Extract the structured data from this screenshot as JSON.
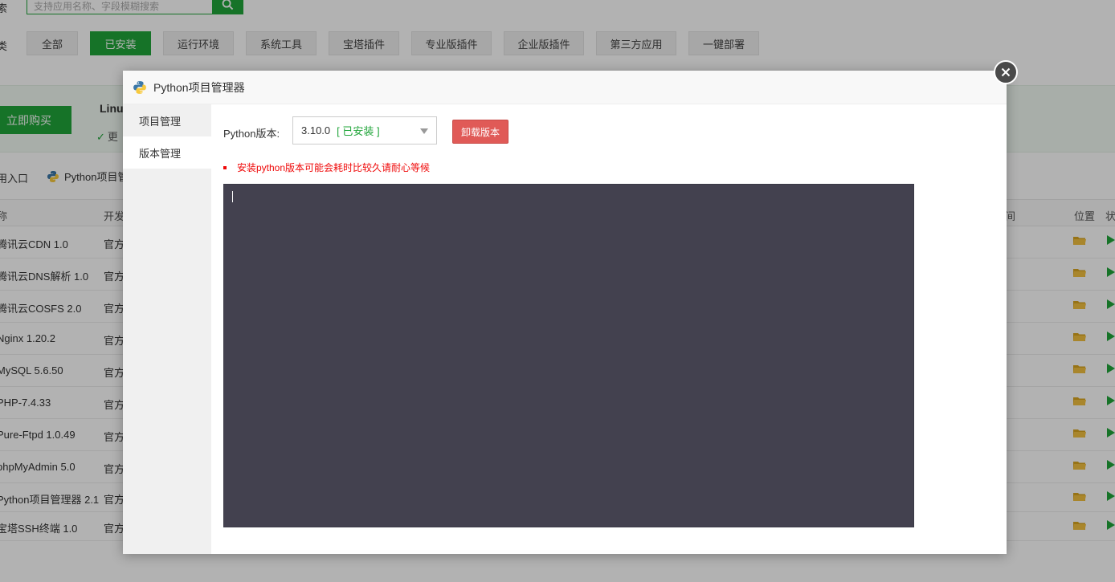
{
  "search": {
    "label": "索",
    "placeholder": "支持应用名称、字段模糊搜索"
  },
  "categories": {
    "label": "类",
    "items": [
      {
        "label": "全部",
        "active": false
      },
      {
        "label": "已安装",
        "active": true
      },
      {
        "label": "运行环境",
        "active": false
      },
      {
        "label": "系统工具",
        "active": false
      },
      {
        "label": "宝塔插件",
        "active": false
      },
      {
        "label": "专业版插件",
        "active": false
      },
      {
        "label": "企业版插件",
        "active": false
      },
      {
        "label": "第三方应用",
        "active": false
      },
      {
        "label": "一键部署",
        "active": false
      }
    ]
  },
  "banner": {
    "buy_label": "立即购买",
    "title": "Linu",
    "subtitle": "更"
  },
  "quick": {
    "entry": "用入口",
    "python": "Python项目管"
  },
  "table": {
    "headers": {
      "name": "称",
      "dev": "开发",
      "time": "间",
      "location": "位置",
      "status": "状"
    },
    "rows": [
      {
        "name": "腾讯云CDN 1.0",
        "dev": "官方"
      },
      {
        "name": "腾讯云DNS解析 1.0",
        "dev": "官方"
      },
      {
        "name": "腾讯云COSFS 2.0",
        "dev": "官方"
      },
      {
        "name": "Nginx 1.20.2",
        "dev": "官方"
      },
      {
        "name": "MySQL 5.6.50",
        "dev": "官方"
      },
      {
        "name": "PHP-7.4.33",
        "dev": "官方"
      },
      {
        "name": "Pure-Ftpd 1.0.49",
        "dev": "官方"
      },
      {
        "name": "phpMyAdmin 5.0",
        "dev": "官方"
      },
      {
        "name": "Python项目管理器 2.1",
        "dev": "官方"
      },
      {
        "name": "宝塔SSH终端 1.0",
        "dev": "官方"
      }
    ]
  },
  "modal": {
    "title": "Python项目管理器",
    "icon": "python-logo-icon",
    "tabs": [
      {
        "label": "项目管理",
        "active": false
      },
      {
        "label": "版本管理",
        "active": true
      }
    ],
    "version_label": "Python版本:",
    "version_value": "3.10.0",
    "version_tag": "[ 已安装 ]",
    "uninstall_label": "卸载版本",
    "warning": "安装python版本可能会耗时比较久请耐心等候"
  },
  "colors": {
    "accent": "#20a53a",
    "danger": "#e05a57",
    "console_bg": "#43414f",
    "warning_text": "#ef0808"
  }
}
